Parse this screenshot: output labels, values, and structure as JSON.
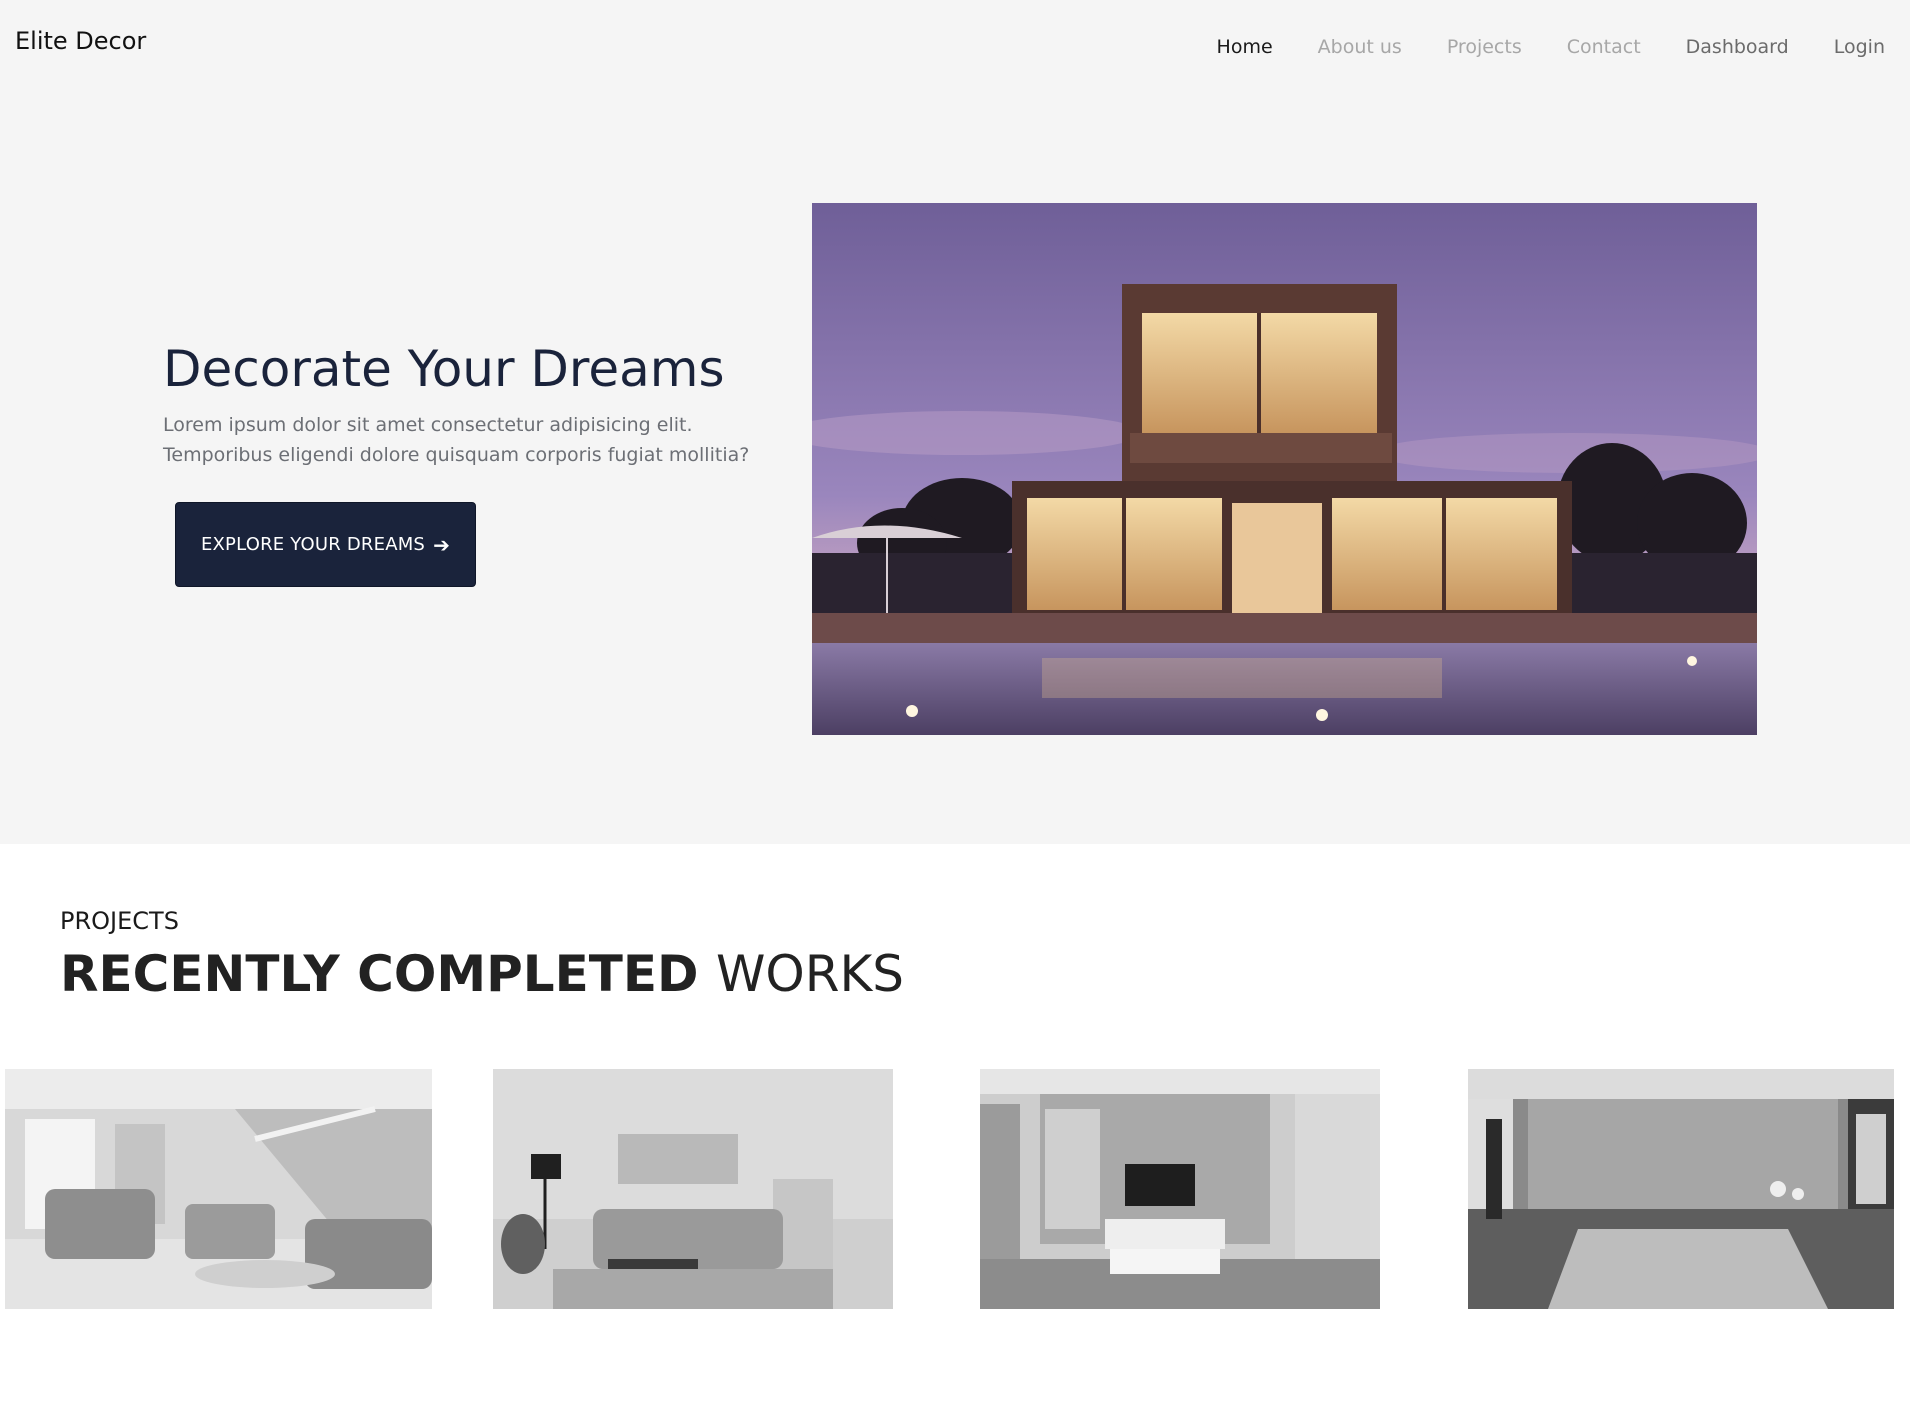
{
  "brand": "Elite Decor",
  "nav": [
    {
      "label": "Home"
    },
    {
      "label": "About us"
    },
    {
      "label": "Projects"
    },
    {
      "label": "Contact"
    },
    {
      "label": "Dashboard"
    },
    {
      "label": "Login"
    }
  ],
  "hero": {
    "title": "Decorate Your Dreams",
    "description": "Lorem ipsum dolor sit amet consectetur adipisicing elit. Temporibus eligendi dolore quisquam corporis fugiat mollitia?",
    "button_label": "EXPLORE YOUR DREAMS",
    "button_icon": "arrow-right-icon",
    "image": "modern-house-at-dusk"
  },
  "projects": {
    "label": "PROJECTS",
    "heading_strong": "RECENTLY COMPLETED",
    "heading_light": "WORKS",
    "images": [
      "living-room-with-staircase",
      "living-room-with-sofa",
      "tv-room-with-shelves",
      "bedroom"
    ]
  },
  "colors": {
    "hero_bg": "#f5f5f5",
    "primary_dark": "#1a233b",
    "text_muted": "#6c6f75"
  }
}
